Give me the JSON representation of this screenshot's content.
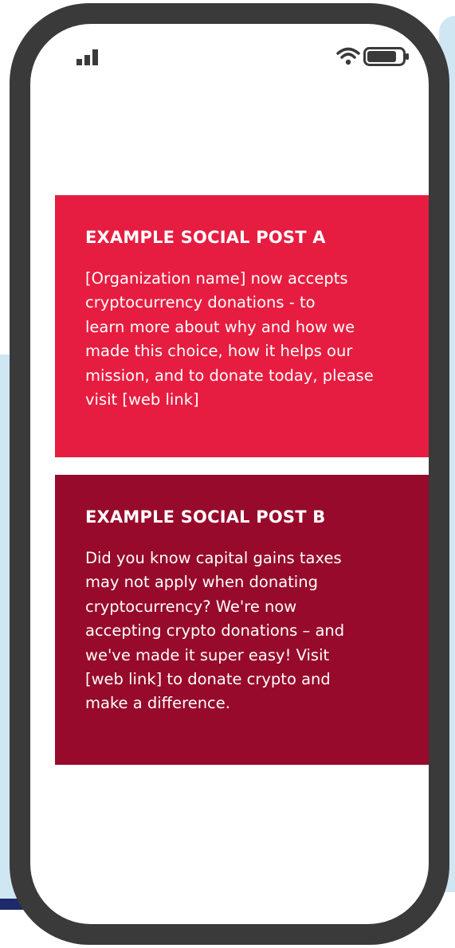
{
  "status_bar": {
    "signal_icon": "signal-bars-icon",
    "wifi_icon": "wifi-icon",
    "battery_icon": "battery-icon"
  },
  "colors": {
    "frame": "#3a3a3a",
    "card_a_background": "#e61d40",
    "card_b_background": "#970a2b",
    "backdrop_accent": "#cfe6f3",
    "backdrop_bar": "#1d2a6b"
  },
  "posts": [
    {
      "title": "EXAMPLE SOCIAL POST A",
      "body": "[Organization name] now accepts\ncryptocurrency donations - to\nlearn more about why and how we\nmade this choice, how it helps our\nmission, and to donate today, please\nvisit [web link]"
    },
    {
      "title": "EXAMPLE SOCIAL POST B",
      "body": "Did you know capital gains taxes\nmay not apply when donating\ncryptocurrency? We're now\naccepting crypto donations – and\nwe've made it super easy! Visit\n[web link] to donate crypto and\nmake a difference."
    }
  ]
}
